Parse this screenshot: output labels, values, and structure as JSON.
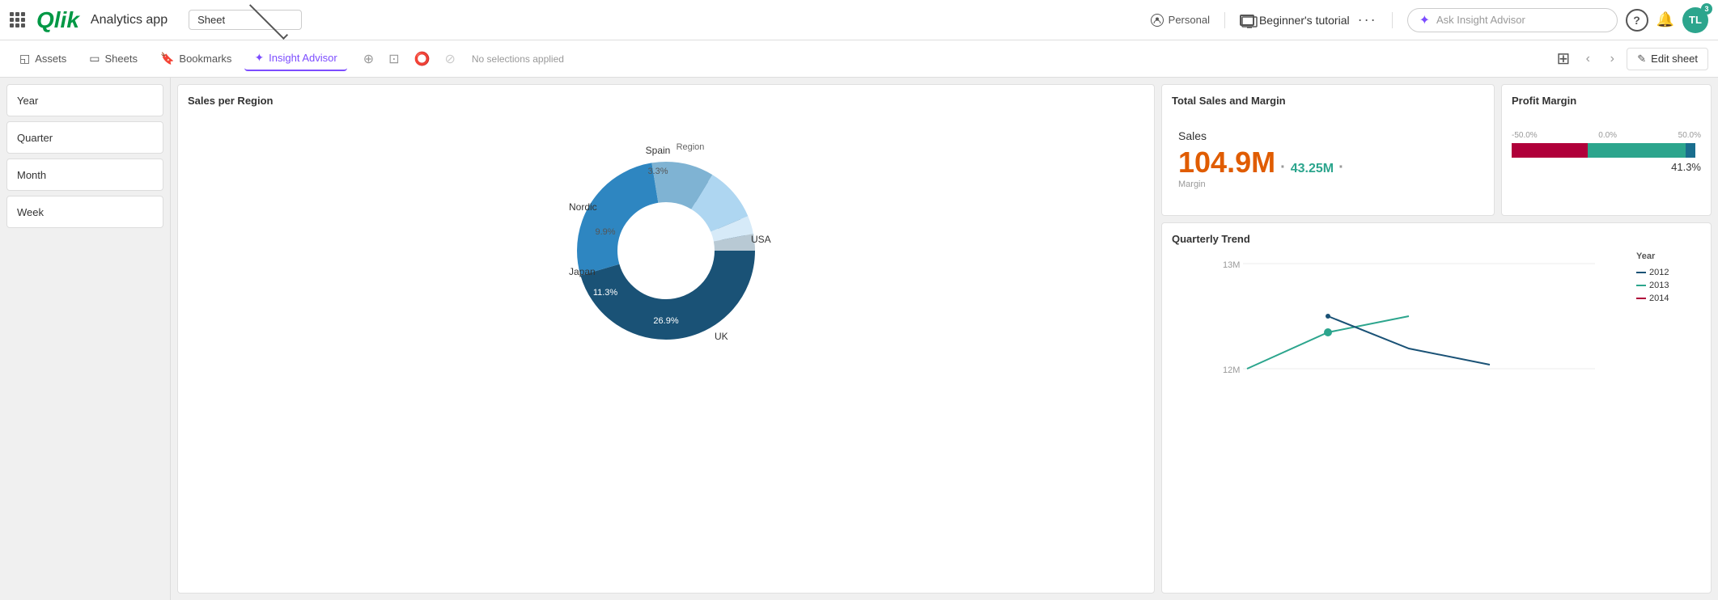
{
  "app": {
    "name": "Analytics app",
    "logo": "Qlik"
  },
  "topbar": {
    "sheet_label": "Sheet",
    "personal_label": "Personal",
    "tutorial_label": "Beginner's tutorial",
    "dots": "···",
    "insight_placeholder": "Ask Insight Advisor",
    "help": "?",
    "badge_count": "3",
    "avatar": "TL"
  },
  "secondbar": {
    "assets": "Assets",
    "sheets": "Sheets",
    "bookmarks": "Bookmarks",
    "insight_advisor": "Insight Advisor",
    "no_selections": "No selections applied",
    "edit_sheet": "Edit sheet"
  },
  "sidebar": {
    "filters": [
      "Year",
      "Quarter",
      "Month",
      "Week"
    ]
  },
  "insight_panel": {
    "title": "Insight Advisor"
  },
  "sales_region": {
    "title": "Sales per Region",
    "segments": [
      {
        "label": "USA",
        "value": 45.5,
        "color": "#1a5276"
      },
      {
        "label": "UK",
        "value": 26.9,
        "color": "#2e86c1"
      },
      {
        "label": "Japan",
        "value": 11.3,
        "color": "#7fb3d3"
      },
      {
        "label": "Nordic",
        "value": 9.9,
        "color": "#aed6f1"
      },
      {
        "label": "Spain",
        "value": 3.3,
        "color": "#d6eaf8"
      },
      {
        "label": "Region",
        "value": 3.1,
        "color": "#b0c4de"
      }
    ]
  },
  "total_sales": {
    "title": "Total Sales and Margin",
    "sales_label": "Sales",
    "sales_value": "104.9M",
    "margin_value": "43.25M",
    "margin_label": "Margin"
  },
  "profit_margin": {
    "title": "Profit Margin",
    "axis_neg": "-50.0%",
    "axis_zero": "0.0%",
    "axis_pos": "50.0%",
    "percentage": "41.3%"
  },
  "quarterly_trend": {
    "title": "Quarterly Trend",
    "y_top": "13M",
    "y_bottom": "12M",
    "legend_title": "Year",
    "years": [
      {
        "label": "2012",
        "color": "#1a5276"
      },
      {
        "label": "2013",
        "color": "#2ca58d"
      },
      {
        "label": "2014",
        "color": "#b0003a"
      }
    ]
  }
}
